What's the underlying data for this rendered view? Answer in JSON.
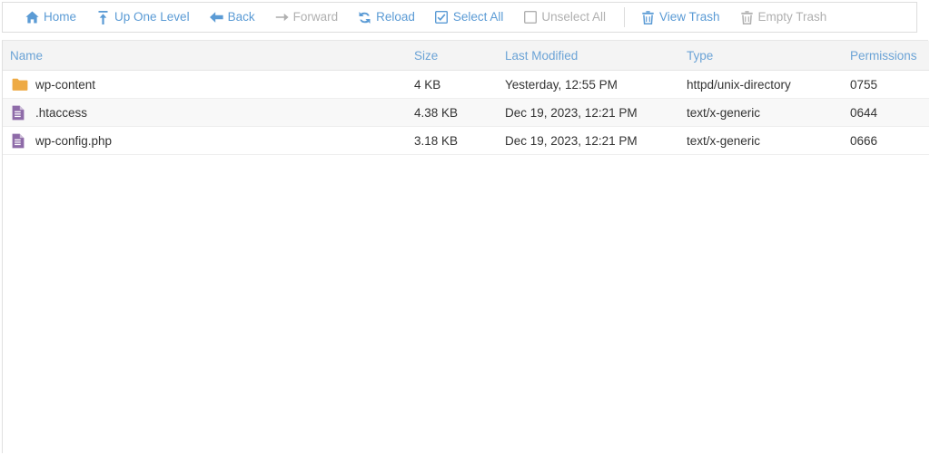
{
  "colors": {
    "accent": "#5b9bd5",
    "header_text": "#6ba3d6",
    "disabled": "#b0b0b0",
    "folder": "#eeaa44",
    "file": "#8e6ba8",
    "row_stripe": "#f8f8f8",
    "header_bg": "#f4f4f4",
    "border": "#dddddd",
    "text": "#333333"
  },
  "toolbar": {
    "items": [
      {
        "label": "Home",
        "icon": "home-icon",
        "state": "enabled"
      },
      {
        "label": "Up One Level",
        "icon": "up-arrow-icon",
        "state": "enabled"
      },
      {
        "label": "Back",
        "icon": "arrow-left-icon",
        "state": "enabled"
      },
      {
        "label": "Forward",
        "icon": "arrow-right-icon",
        "state": "disabled"
      },
      {
        "label": "Reload",
        "icon": "reload-icon",
        "state": "enabled"
      },
      {
        "label": "Select All",
        "icon": "checkbox-checked-icon",
        "state": "enabled"
      },
      {
        "label": "Unselect All",
        "icon": "checkbox-empty-icon",
        "state": "disabled"
      },
      {
        "label": "View Trash",
        "icon": "trash-icon",
        "state": "enabled"
      },
      {
        "label": "Empty Trash",
        "icon": "trash-icon",
        "state": "disabled"
      }
    ],
    "divider_after_index": 6
  },
  "table": {
    "columns": [
      {
        "key": "name",
        "label": "Name"
      },
      {
        "key": "size",
        "label": "Size"
      },
      {
        "key": "modified",
        "label": "Last Modified"
      },
      {
        "key": "type",
        "label": "Type"
      },
      {
        "key": "permissions",
        "label": "Permissions"
      }
    ],
    "rows": [
      {
        "icon": "folder-icon",
        "name": "wp-content",
        "size": "4 KB",
        "modified": "Yesterday, 12:55 PM",
        "type": "httpd/unix-directory",
        "permissions": "0755"
      },
      {
        "icon": "file-icon",
        "name": ".htaccess",
        "size": "4.38 KB",
        "modified": "Dec 19, 2023, 12:21 PM",
        "type": "text/x-generic",
        "permissions": "0644"
      },
      {
        "icon": "file-icon",
        "name": "wp-config.php",
        "size": "3.18 KB",
        "modified": "Dec 19, 2023, 12:21 PM",
        "type": "text/x-generic",
        "permissions": "0666"
      }
    ]
  }
}
